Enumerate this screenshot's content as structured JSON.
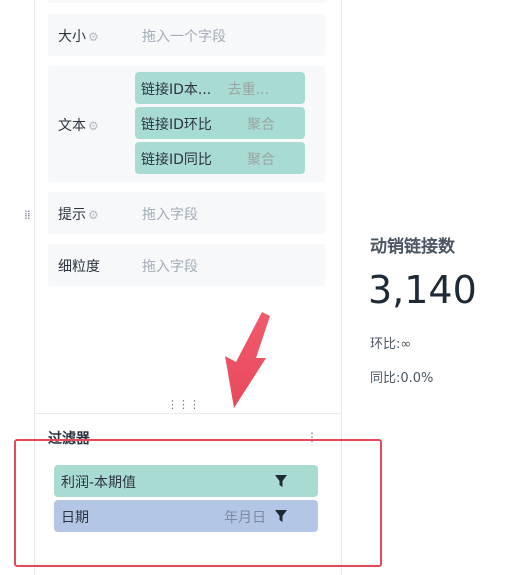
{
  "fields": {
    "size": {
      "label": "大小",
      "placeholder": "拖入一个字段"
    },
    "text": {
      "label": "文本",
      "pills": [
        {
          "name": "链接ID本...",
          "agg": "去重..."
        },
        {
          "name": "链接ID环比",
          "agg": "聚合"
        },
        {
          "name": "链接ID同比",
          "agg": "聚合"
        }
      ]
    },
    "tooltip": {
      "label": "提示",
      "placeholder": "拖入字段"
    },
    "granularity": {
      "label": "细粒度",
      "placeholder": "拖入字段"
    }
  },
  "filters": {
    "title": "过滤器",
    "more": "⋮",
    "items": [
      {
        "name": "利润-本期值",
        "extra": "",
        "color": "#a8dcd2"
      },
      {
        "name": "日期",
        "extra": "年月日",
        "color": "#b3c6e6"
      }
    ]
  },
  "kpi": {
    "title": "动销链接数",
    "value": "3,140",
    "mom": "环比:∞",
    "yoy": "同比:0.0%"
  },
  "colors": {
    "highlight": "#e8485b",
    "pill_teal": "#a8dcd2",
    "pill_blue": "#b3c6e6"
  }
}
